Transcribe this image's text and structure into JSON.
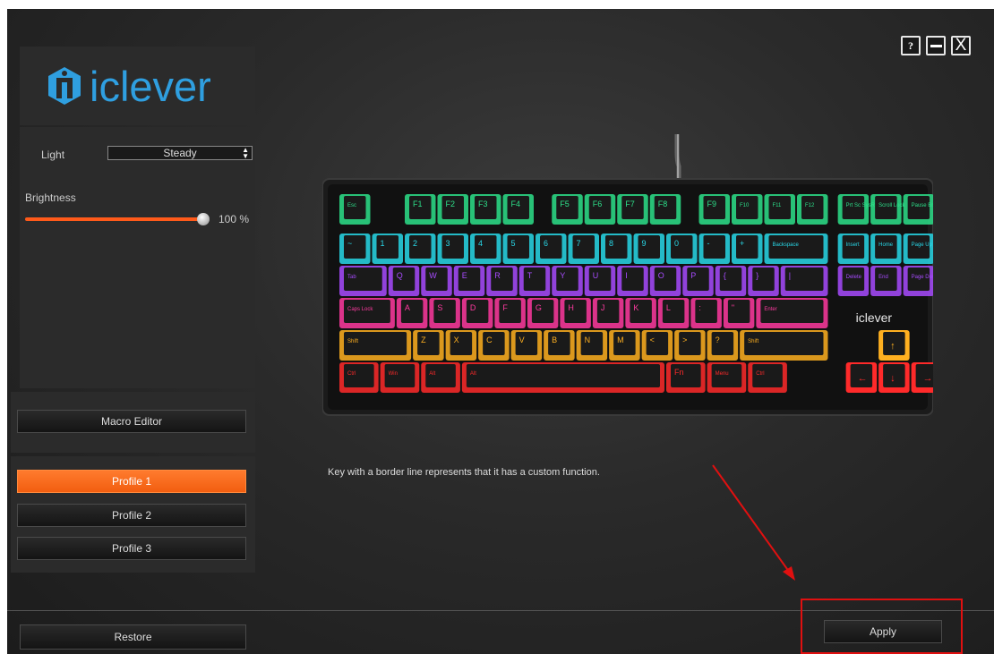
{
  "window": {
    "help_label": "?",
    "close_label": "X"
  },
  "logo": {
    "text": "iclever",
    "color": "#2f9fe0"
  },
  "light": {
    "label": "Light",
    "mode": "Steady",
    "brightness_label": "Brightness",
    "brightness_value": "100 %",
    "brightness_fraction": 1.0,
    "slider_color": "#ff5a1a"
  },
  "macro": {
    "label": "Macro Editor"
  },
  "profiles": [
    {
      "label": "Profile 1",
      "active": true
    },
    {
      "label": "Profile 2",
      "active": false
    },
    {
      "label": "Profile 3",
      "active": false
    }
  ],
  "caption": "Key with a border line represents that it has a custom function.",
  "buttons": {
    "restore": "Restore",
    "apply": "Apply"
  },
  "keyboard": {
    "brand": "iclever",
    "rows": [
      [
        "Esc",
        "F1",
        "F2",
        "F3",
        "F4",
        "F5",
        "F6",
        "F7",
        "F8",
        "F9",
        "F10",
        "F11",
        "F12",
        "Prt Sc SysRq",
        "Scroll Lock",
        "Pause Break"
      ],
      [
        "~",
        "1",
        "2",
        "3",
        "4",
        "5",
        "6",
        "7",
        "8",
        "9",
        "0",
        "-",
        "+",
        "Backspace",
        "Insert",
        "Home",
        "Page Up"
      ],
      [
        "Tab",
        "Q",
        "W",
        "E",
        "R",
        "T",
        "Y",
        "U",
        "I",
        "O",
        "P",
        "{",
        "}",
        "|",
        "Delete",
        "End",
        "Page Down"
      ],
      [
        "Caps Lock",
        "A",
        "S",
        "D",
        "F",
        "G",
        "H",
        "J",
        "K",
        "L",
        ":",
        "\"",
        "Enter"
      ],
      [
        "Shift",
        "Z",
        "X",
        "C",
        "V",
        "B",
        "N",
        "M",
        "<",
        ">",
        "?",
        "Shift"
      ],
      [
        "Ctrl",
        "Win",
        "Alt",
        "Alt",
        "Fn",
        "Menu",
        "Ctrl"
      ]
    ],
    "row_colors": [
      "#2de08a",
      "#28d8e8",
      "#a84bff",
      "#ff3aa0",
      "#ffb020",
      "#ff2a2a"
    ]
  }
}
